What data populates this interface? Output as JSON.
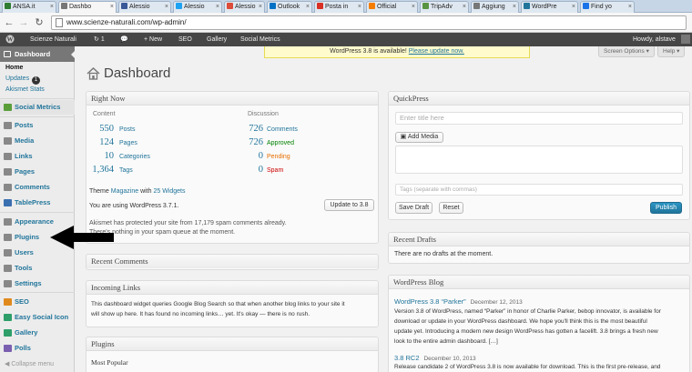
{
  "browser": {
    "tabs": [
      {
        "label": "ANSA.it",
        "color": "#2e7d32",
        "active": false
      },
      {
        "label": "Dashbo",
        "color": "#777777",
        "active": true
      },
      {
        "label": "Alessio",
        "color": "#3b5998",
        "active": false
      },
      {
        "label": "Alessio",
        "color": "#1da1f2",
        "active": false
      },
      {
        "label": "Alessio",
        "color": "#dd4b39",
        "active": false
      },
      {
        "label": "Outlook",
        "color": "#0072c6",
        "active": false
      },
      {
        "label": "Posta in",
        "color": "#d93025",
        "active": false
      },
      {
        "label": "Official",
        "color": "#f57d00",
        "active": false
      },
      {
        "label": "TripAdv",
        "color": "#589442",
        "active": false
      },
      {
        "label": "Aggiung",
        "color": "#777777",
        "active": false
      },
      {
        "label": "WordPre",
        "color": "#21759b",
        "active": false
      },
      {
        "label": "Find yo",
        "color": "#1a73e8",
        "active": false
      }
    ],
    "url": "www.scienze-naturali.com/wp-admin/"
  },
  "adminbar": {
    "site": "Scienze Naturali",
    "updates_count": "1",
    "new_label": "+ New",
    "seo": "SEO",
    "gallery": "Gallery",
    "social": "Social Metrics",
    "howdy": "Howdy, alstave"
  },
  "sidebar": {
    "dashboard": "Dashboard",
    "home": "Home",
    "updates": "Updates",
    "updates_badge": "1",
    "akismet": "Akismet Stats",
    "items": [
      {
        "label": "Social Metrics",
        "color": "#5a9e3a"
      },
      {
        "label": "Posts",
        "color": "#888888"
      },
      {
        "label": "Media",
        "color": "#888888"
      },
      {
        "label": "Links",
        "color": "#888888"
      },
      {
        "label": "Pages",
        "color": "#888888"
      },
      {
        "label": "Comments",
        "color": "#888888"
      },
      {
        "label": "TablePress",
        "color": "#3a6fb0"
      },
      {
        "label": "Appearance",
        "color": "#888888"
      },
      {
        "label": "Plugins",
        "color": "#888888"
      },
      {
        "label": "Users",
        "color": "#888888"
      },
      {
        "label": "Tools",
        "color": "#888888"
      },
      {
        "label": "Settings",
        "color": "#888888"
      },
      {
        "label": "SEO",
        "color": "#e08a1e"
      },
      {
        "label": "Easy Social Icon",
        "color": "#2e9e6a"
      },
      {
        "label": "Gallery",
        "color": "#2e9e6a"
      },
      {
        "label": "Polls",
        "color": "#7a5fb0"
      }
    ],
    "collapse": "Collapse menu"
  },
  "notice": {
    "text": "WordPress 3.8 is available!",
    "link": "Please update now."
  },
  "screen_options": "Screen Options ▾",
  "help": "Help ▾",
  "page_title": "Dashboard",
  "right_now": {
    "title": "Right Now",
    "content_h": "Content",
    "discussion_h": "Discussion",
    "content": [
      {
        "num": "550",
        "label": "Posts"
      },
      {
        "num": "124",
        "label": "Pages"
      },
      {
        "num": "10",
        "label": "Categories"
      },
      {
        "num": "1,364",
        "label": "Tags"
      }
    ],
    "discussion": [
      {
        "num": "726",
        "label": "Comments",
        "color": "#21759b"
      },
      {
        "num": "726",
        "label": "Approved",
        "color": "#008000"
      },
      {
        "num": "0",
        "label": "Pending",
        "color": "#e66f00"
      },
      {
        "num": "0",
        "label": "Spam",
        "color": "#cc0000"
      }
    ],
    "theme_pre": "Theme",
    "theme": "Magazine",
    "theme_mid": "with",
    "widgets": "25 Widgets",
    "version": "You are using WordPress 3.7.1.",
    "update_btn": "Update to 3.8",
    "akismet_line1": "Akismet has protected your site from 17,179 spam comments already.",
    "akismet_line2": "There's nothing in your spam queue at the moment."
  },
  "recent_comments": {
    "title": "Recent Comments"
  },
  "incoming_links": {
    "title": "Incoming Links",
    "text1": "This dashboard widget queries Google Blog Search so that when another blog links to your site it",
    "text2": "will show up here. It has found no incoming links… yet. It's okay — there is no rush."
  },
  "plugins": {
    "title": "Plugins",
    "most_popular": "Most Popular"
  },
  "quickpress": {
    "title": "QuickPress",
    "title_placeholder": "Enter title here",
    "add_media": "Add Media",
    "tags_placeholder": "Tags (separate with commas)",
    "save_draft": "Save Draft",
    "reset": "Reset",
    "publish": "Publish"
  },
  "recent_drafts": {
    "title": "Recent Drafts",
    "text": "There are no drafts at the moment."
  },
  "wp_blog": {
    "title": "WordPress Blog",
    "post1_title": "WordPress 3.8 “Parker”",
    "post1_date": "December 12, 2013",
    "post1_lines": [
      "Version 3.8 of WordPress, named “Parker” in honor of Charlie Parker, bebop innovator, is available for",
      "download or update in your WordPress dashboard. We hope you'll think this is the most beautiful",
      "update yet. Introducing a modern new design WordPress has gotten a facelift. 3.8 brings a fresh new",
      "look to the entire admin dashboard. […]"
    ],
    "post2_title": "3.8 RC2",
    "post2_date": "December 10, 2013",
    "post2_line": "Release candidate 2 of WordPress 3.8 is now available for download. This is the first pre-release, and"
  }
}
